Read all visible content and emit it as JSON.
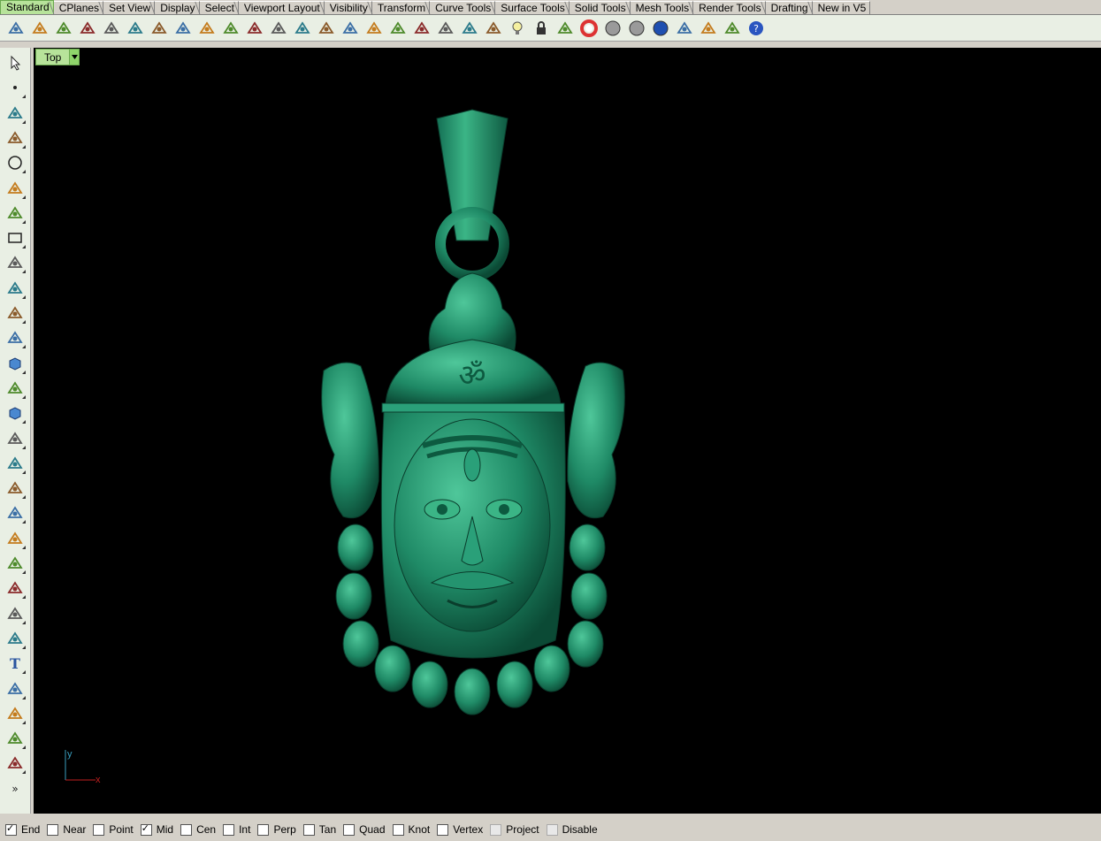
{
  "tabs": [
    {
      "label": "Standard",
      "active": true
    },
    {
      "label": "CPlanes"
    },
    {
      "label": "Set View"
    },
    {
      "label": "Display"
    },
    {
      "label": "Select"
    },
    {
      "label": "Viewport Layout"
    },
    {
      "label": "Visibility"
    },
    {
      "label": "Transform"
    },
    {
      "label": "Curve Tools"
    },
    {
      "label": "Surface Tools"
    },
    {
      "label": "Solid Tools"
    },
    {
      "label": "Mesh Tools"
    },
    {
      "label": "Render Tools"
    },
    {
      "label": "Drafting"
    },
    {
      "label": "New in V5"
    }
  ],
  "toolbar_icons": [
    "new-file",
    "open-file",
    "save",
    "print",
    "import",
    "cut",
    "copy",
    "paste",
    "undo",
    "pan",
    "rotate-view",
    "zoom-dynamic",
    "zoom-window",
    "zoom-extents",
    "zoom-selected",
    "rotate-view-3d",
    "four-viewports",
    "car-rendered",
    "wireframe-car",
    "layer-off",
    "osnap-point",
    "light-bulb",
    "lock",
    "layer-color",
    "color-wheel",
    "shaded-sphere",
    "render-sphere",
    "blue-sphere",
    "spotlight",
    "gear-options",
    "dimension",
    "help"
  ],
  "left_toolbar_icons": [
    "select-arrow",
    "point",
    "polyline",
    "curve-control-points",
    "circle",
    "ellipse",
    "arc",
    "rectangle",
    "polygon",
    "fillet-curve",
    "surface-from-points",
    "extrude-surface",
    "solid-box",
    "boolean-union",
    "cylinder",
    "plane-surface",
    "transform-gear",
    "explode",
    "extend",
    "trim",
    "boolean-solids",
    "array",
    "offset",
    "blend-curve",
    "text",
    "scale",
    "group",
    "make-2d",
    "solid-edit",
    "more"
  ],
  "viewport": {
    "title": "Top",
    "background": "#000000",
    "model_color": "#1f8a66",
    "axis": {
      "x": "x",
      "y": "y"
    }
  },
  "osnaps": [
    {
      "label": "End",
      "checked": true
    },
    {
      "label": "Near",
      "checked": false
    },
    {
      "label": "Point",
      "checked": false
    },
    {
      "label": "Mid",
      "checked": true
    },
    {
      "label": "Cen",
      "checked": false
    },
    {
      "label": "Int",
      "checked": false
    },
    {
      "label": "Perp",
      "checked": false
    },
    {
      "label": "Tan",
      "checked": false
    },
    {
      "label": "Quad",
      "checked": false
    },
    {
      "label": "Knot",
      "checked": false
    },
    {
      "label": "Vertex",
      "checked": false
    },
    {
      "label": "Project",
      "checked": false,
      "disabled": true
    },
    {
      "label": "Disable",
      "checked": false,
      "disabled": true
    }
  ],
  "colors": {
    "tab_active": "#b7e39a",
    "toolbar_bg": "#e9efe4",
    "chrome": "#d4d0c8"
  }
}
